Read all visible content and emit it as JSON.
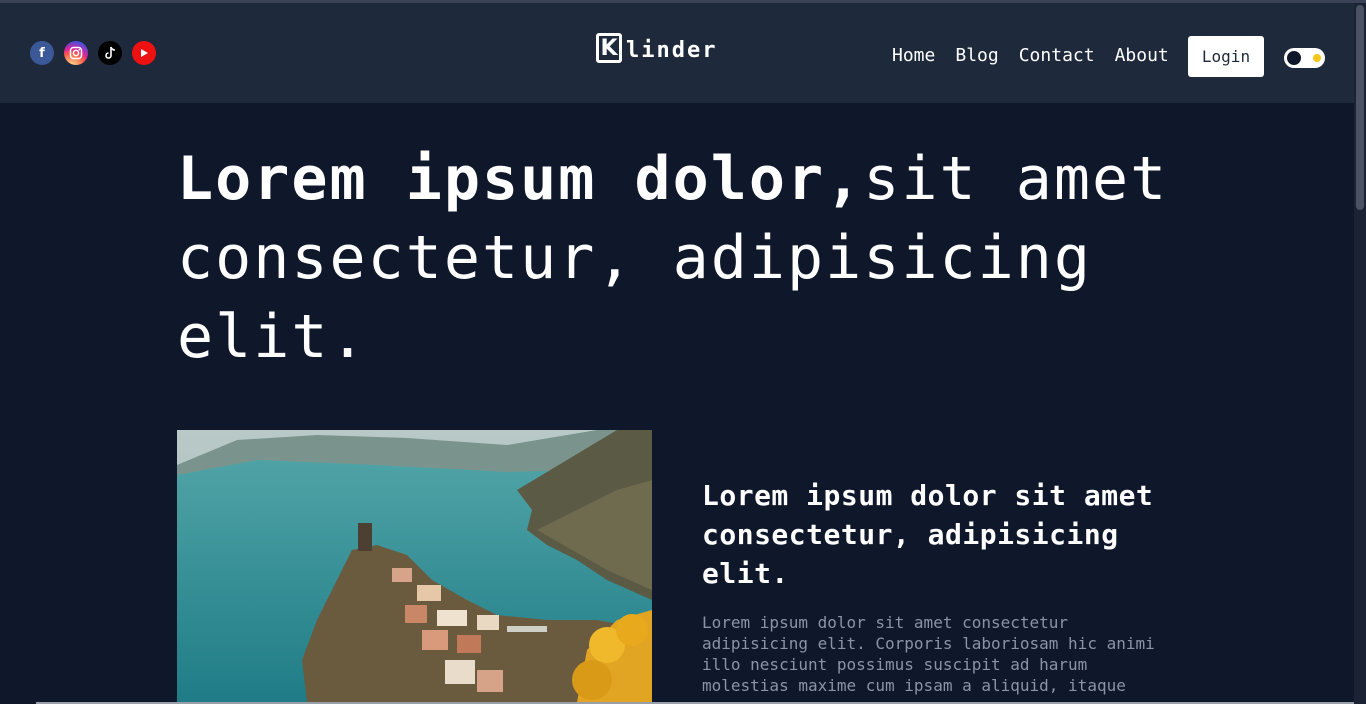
{
  "social": {
    "facebook_icon": "facebook-icon",
    "instagram_icon": "instagram-icon",
    "tiktok_icon": "tiktok-icon",
    "youtube_icon": "youtube-icon"
  },
  "logo": {
    "letter": "K",
    "text": "linder"
  },
  "nav": {
    "home": "Home",
    "blog": "Blog",
    "contact": "Contact",
    "about": "About"
  },
  "login_label": "Login",
  "hero": {
    "bold": "Lorem ipsum dolor,",
    "rest": "sit amet consectetur, adipisicing elit."
  },
  "article": {
    "heading": "Lorem ipsum dolor sit amet consectetur, adipisicing elit.",
    "body": "Lorem ipsum dolor sit amet consectetur adipisicing elit. Corporis laboriosam hic animi illo nesciunt possimus suscipit ad harum molestias maxime cum ipsam a aliquid, itaque"
  },
  "colors": {
    "background": "#0f172a",
    "header": "#1e293b",
    "accent_sun": "#f5c518"
  }
}
